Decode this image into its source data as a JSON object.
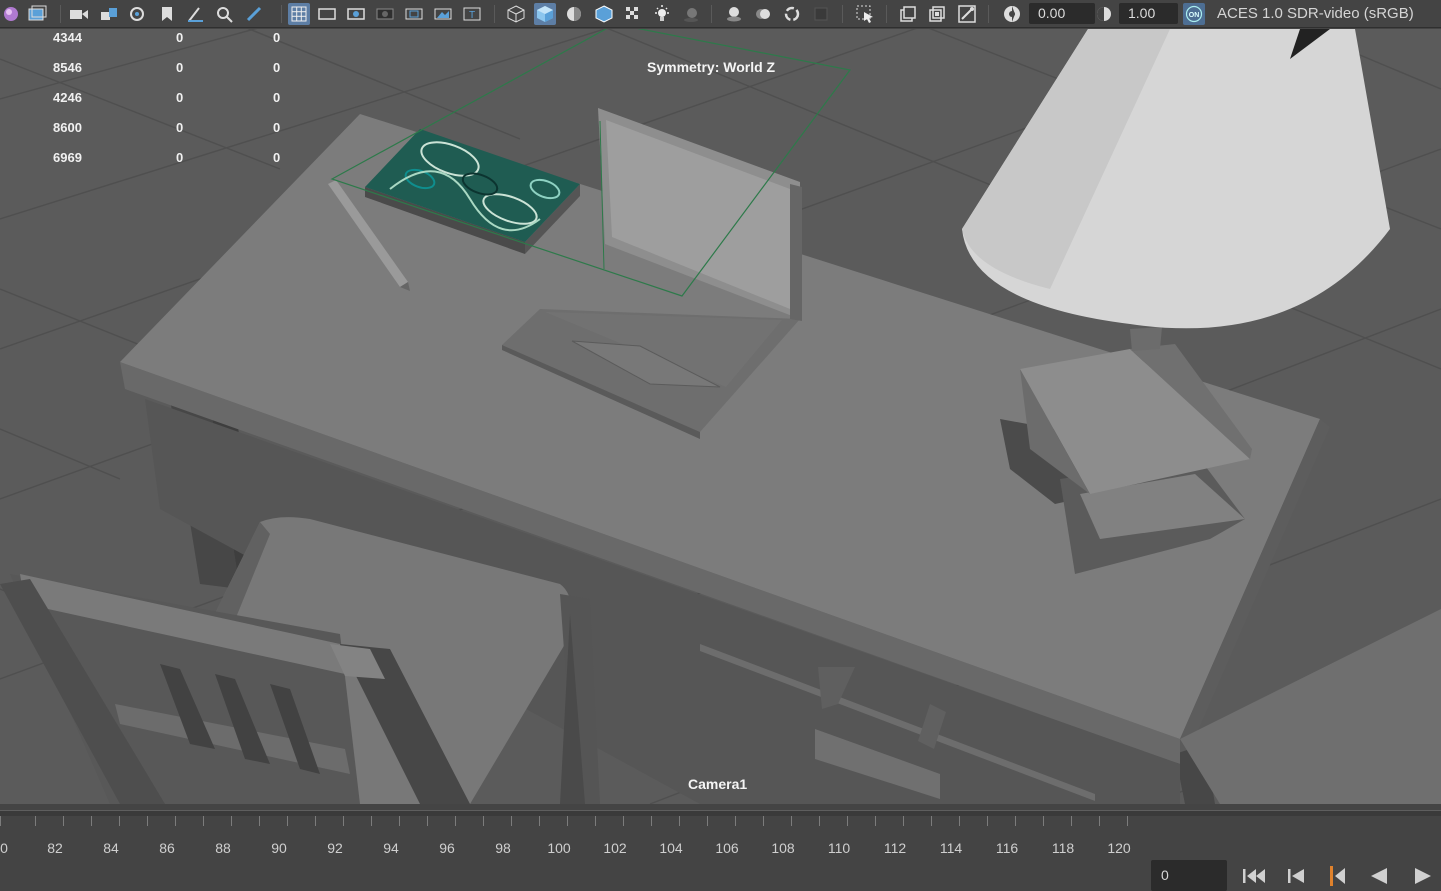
{
  "toolbar": {
    "exposure_value": "0.00",
    "gamma_value": "1.00",
    "color_management_badge": "ON",
    "color_space": "ACES 1.0 SDR-video (sRGB)"
  },
  "hud": {
    "rows": [
      [
        "4344",
        "0",
        "0"
      ],
      [
        "8546",
        "0",
        "0"
      ],
      [
        "4246",
        "0",
        "0"
      ],
      [
        "8600",
        "0",
        "0"
      ],
      [
        "6969",
        "0",
        "0"
      ]
    ],
    "symmetry_label": "Symmetry: World Z",
    "camera_label": "Camera1"
  },
  "timeline": {
    "ticks": [
      "0",
      "82",
      "84",
      "86",
      "88",
      "90",
      "92",
      "94",
      "96",
      "98",
      "100",
      "102",
      "104",
      "106",
      "108",
      "110",
      "112",
      "114",
      "116",
      "118",
      "120"
    ],
    "current_frame": "0"
  },
  "colors": {
    "toolbar_bg": "#444444",
    "viewport_bg": "#5b5b5b",
    "active_button": "#5d7ea5",
    "symmetry_plane": "#2d7a4a",
    "current_frame_marker": "#e0822c"
  }
}
